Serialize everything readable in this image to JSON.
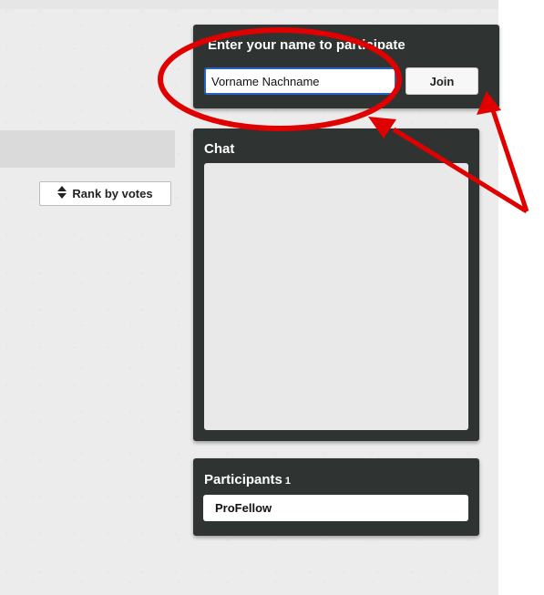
{
  "toolbar": {
    "rank_label": "Rank by votes",
    "rank_icon": "sort-updown-icon"
  },
  "join_panel": {
    "title": "Enter your name to participate",
    "input_value": "Vorname Nachname",
    "join_label": "Join"
  },
  "chat_panel": {
    "title": "Chat"
  },
  "participants_panel": {
    "title": "Participants",
    "count": "1",
    "items": [
      "ProFellow"
    ]
  },
  "annotations": {
    "color": "#e00000",
    "shapes": [
      "ellipse-highlight",
      "arrow",
      "arrow",
      "arrow"
    ]
  },
  "colors": {
    "panel_bg": "#2f3432",
    "input_border": "#2a63c8",
    "page_bg": "#ececec"
  }
}
